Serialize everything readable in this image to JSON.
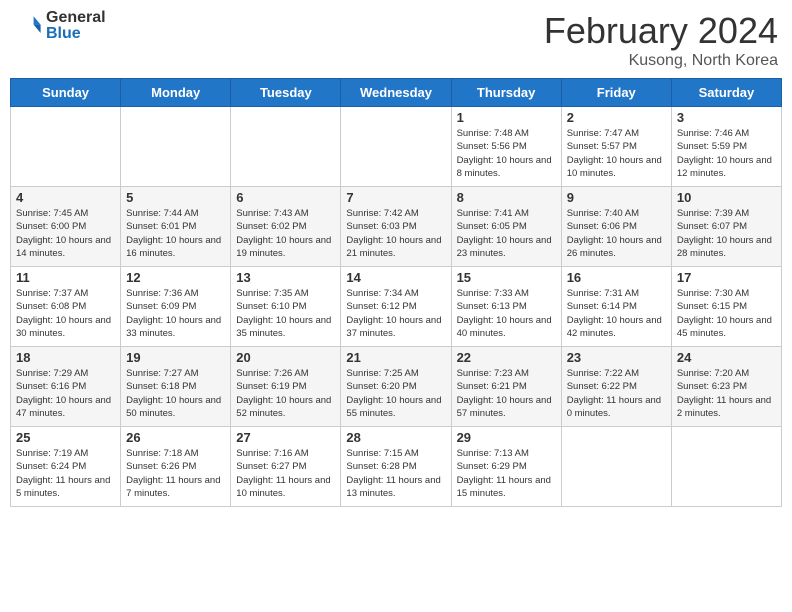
{
  "header": {
    "logo_general": "General",
    "logo_blue": "Blue",
    "title": "February 2024",
    "location": "Kusong, North Korea"
  },
  "days_of_week": [
    "Sunday",
    "Monday",
    "Tuesday",
    "Wednesday",
    "Thursday",
    "Friday",
    "Saturday"
  ],
  "weeks": [
    [
      {
        "day": "",
        "info": ""
      },
      {
        "day": "",
        "info": ""
      },
      {
        "day": "",
        "info": ""
      },
      {
        "day": "",
        "info": ""
      },
      {
        "day": "1",
        "info": "Sunrise: 7:48 AM\nSunset: 5:56 PM\nDaylight: 10 hours\nand 8 minutes."
      },
      {
        "day": "2",
        "info": "Sunrise: 7:47 AM\nSunset: 5:57 PM\nDaylight: 10 hours\nand 10 minutes."
      },
      {
        "day": "3",
        "info": "Sunrise: 7:46 AM\nSunset: 5:59 PM\nDaylight: 10 hours\nand 12 minutes."
      }
    ],
    [
      {
        "day": "4",
        "info": "Sunrise: 7:45 AM\nSunset: 6:00 PM\nDaylight: 10 hours\nand 14 minutes."
      },
      {
        "day": "5",
        "info": "Sunrise: 7:44 AM\nSunset: 6:01 PM\nDaylight: 10 hours\nand 16 minutes."
      },
      {
        "day": "6",
        "info": "Sunrise: 7:43 AM\nSunset: 6:02 PM\nDaylight: 10 hours\nand 19 minutes."
      },
      {
        "day": "7",
        "info": "Sunrise: 7:42 AM\nSunset: 6:03 PM\nDaylight: 10 hours\nand 21 minutes."
      },
      {
        "day": "8",
        "info": "Sunrise: 7:41 AM\nSunset: 6:05 PM\nDaylight: 10 hours\nand 23 minutes."
      },
      {
        "day": "9",
        "info": "Sunrise: 7:40 AM\nSunset: 6:06 PM\nDaylight: 10 hours\nand 26 minutes."
      },
      {
        "day": "10",
        "info": "Sunrise: 7:39 AM\nSunset: 6:07 PM\nDaylight: 10 hours\nand 28 minutes."
      }
    ],
    [
      {
        "day": "11",
        "info": "Sunrise: 7:37 AM\nSunset: 6:08 PM\nDaylight: 10 hours\nand 30 minutes."
      },
      {
        "day": "12",
        "info": "Sunrise: 7:36 AM\nSunset: 6:09 PM\nDaylight: 10 hours\nand 33 minutes."
      },
      {
        "day": "13",
        "info": "Sunrise: 7:35 AM\nSunset: 6:10 PM\nDaylight: 10 hours\nand 35 minutes."
      },
      {
        "day": "14",
        "info": "Sunrise: 7:34 AM\nSunset: 6:12 PM\nDaylight: 10 hours\nand 37 minutes."
      },
      {
        "day": "15",
        "info": "Sunrise: 7:33 AM\nSunset: 6:13 PM\nDaylight: 10 hours\nand 40 minutes."
      },
      {
        "day": "16",
        "info": "Sunrise: 7:31 AM\nSunset: 6:14 PM\nDaylight: 10 hours\nand 42 minutes."
      },
      {
        "day": "17",
        "info": "Sunrise: 7:30 AM\nSunset: 6:15 PM\nDaylight: 10 hours\nand 45 minutes."
      }
    ],
    [
      {
        "day": "18",
        "info": "Sunrise: 7:29 AM\nSunset: 6:16 PM\nDaylight: 10 hours\nand 47 minutes."
      },
      {
        "day": "19",
        "info": "Sunrise: 7:27 AM\nSunset: 6:18 PM\nDaylight: 10 hours\nand 50 minutes."
      },
      {
        "day": "20",
        "info": "Sunrise: 7:26 AM\nSunset: 6:19 PM\nDaylight: 10 hours\nand 52 minutes."
      },
      {
        "day": "21",
        "info": "Sunrise: 7:25 AM\nSunset: 6:20 PM\nDaylight: 10 hours\nand 55 minutes."
      },
      {
        "day": "22",
        "info": "Sunrise: 7:23 AM\nSunset: 6:21 PM\nDaylight: 10 hours\nand 57 minutes."
      },
      {
        "day": "23",
        "info": "Sunrise: 7:22 AM\nSunset: 6:22 PM\nDaylight: 11 hours\nand 0 minutes."
      },
      {
        "day": "24",
        "info": "Sunrise: 7:20 AM\nSunset: 6:23 PM\nDaylight: 11 hours\nand 2 minutes."
      }
    ],
    [
      {
        "day": "25",
        "info": "Sunrise: 7:19 AM\nSunset: 6:24 PM\nDaylight: 11 hours\nand 5 minutes."
      },
      {
        "day": "26",
        "info": "Sunrise: 7:18 AM\nSunset: 6:26 PM\nDaylight: 11 hours\nand 7 minutes."
      },
      {
        "day": "27",
        "info": "Sunrise: 7:16 AM\nSunset: 6:27 PM\nDaylight: 11 hours\nand 10 minutes."
      },
      {
        "day": "28",
        "info": "Sunrise: 7:15 AM\nSunset: 6:28 PM\nDaylight: 11 hours\nand 13 minutes."
      },
      {
        "day": "29",
        "info": "Sunrise: 7:13 AM\nSunset: 6:29 PM\nDaylight: 11 hours\nand 15 minutes."
      },
      {
        "day": "",
        "info": ""
      },
      {
        "day": "",
        "info": ""
      }
    ]
  ]
}
